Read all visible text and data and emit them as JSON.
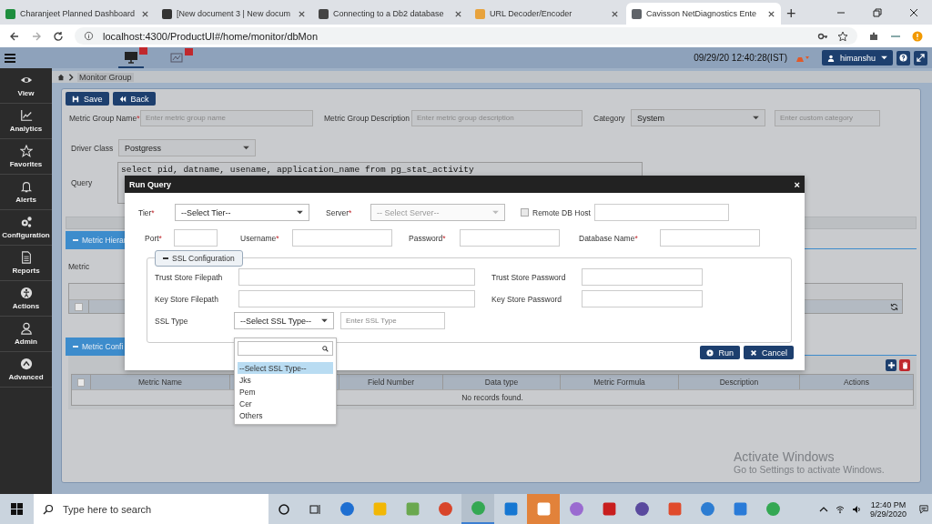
{
  "browser": {
    "tabs": [
      {
        "title": "Charanjeet Planned Dashboard",
        "kind": "sheet",
        "selected": false
      },
      {
        "title": "[New document 3 | New docum",
        "kind": "code",
        "selected": false
      },
      {
        "title": "Connecting to a Db2 database",
        "kind": "link",
        "selected": false
      },
      {
        "title": "URL Decoder/Encoder",
        "kind": "tool",
        "selected": false
      },
      {
        "title": "Cavisson NetDiagnostics Ente",
        "kind": "globe",
        "selected": true
      }
    ],
    "new_tab": "+",
    "url": "localhost:4300/ProductUI#/home/monitor/dbMon"
  },
  "app_header": {
    "datetime": "09/29/20 12:40:28(IST)",
    "user": "himanshu"
  },
  "sidebar": [
    {
      "label": "View",
      "kind": "eye"
    },
    {
      "label": "Analytics",
      "kind": "chart"
    },
    {
      "label": "Favorites",
      "kind": "star"
    },
    {
      "label": "Alerts",
      "kind": "bell"
    },
    {
      "label": "Configuration",
      "kind": "gears"
    },
    {
      "label": "Reports",
      "kind": "doc"
    },
    {
      "label": "Actions",
      "kind": "figure"
    },
    {
      "label": "Admin",
      "kind": "user"
    },
    {
      "label": "Advanced",
      "kind": "up"
    }
  ],
  "breadcrumb": "Monitor Group",
  "toolbar": [
    {
      "label": "Save",
      "kind": "save"
    },
    {
      "label": "Back",
      "kind": "back"
    }
  ],
  "form": {
    "group_name": {
      "label": "Metric Group Name",
      "mark": "*",
      "placeholder": "Enter metric group name"
    },
    "group_description": {
      "label": "Metric Group Description",
      "placeholder": "Enter metric group description"
    },
    "category": {
      "label": "Category",
      "value": "System"
    },
    "custom_category": {
      "placeholder": "Enter custom category"
    },
    "driver_class": {
      "label": "Driver Class",
      "value": "Postgress"
    },
    "query": {
      "label": "Query",
      "value": "select pid, datname, usename, application_name from pg_stat_activity"
    }
  },
  "hierarchy_section": {
    "title": "Metric Hierar",
    "metric_label": "Metric",
    "row_checkbox": {
      "checked": false
    }
  },
  "config_section": {
    "title": "Metric Confi",
    "header_checkbox": {
      "checked": false
    },
    "columns": [
      "Metric Name",
      "Field Number",
      "Data type",
      "Metric Formula",
      "Description",
      "Actions"
    ],
    "empty": "No records found."
  },
  "modal": {
    "title": "Run Query",
    "close": "×",
    "tier": {
      "label": "Tier",
      "mark": "*",
      "value": "--Select Tier--"
    },
    "server": {
      "label": "Server",
      "mark": "*",
      "placeholder": "-- Select Server--",
      "disabled": true
    },
    "remote_db_host": {
      "label": "Remote DB Host",
      "checked": false
    },
    "port": {
      "label": "Port",
      "mark": "*"
    },
    "username": {
      "label": "Username",
      "mark": "*"
    },
    "password": {
      "label": "Password",
      "mark": "*"
    },
    "database_name": {
      "label": "Database Name",
      "mark": "*"
    },
    "ssl": {
      "toggle": "SSL Configuration",
      "expanded": true,
      "trust_store_filepath": "Trust Store Filepath",
      "trust_store_password": "Trust Store Password",
      "key_store_filepath": "Key Store Filepath",
      "key_store_password": "Key Store Password",
      "ssl_type": {
        "label": "SSL Type",
        "value": "--Select SSL Type--"
      },
      "ssl_type_custom": {
        "placeholder": "Enter SSL Type"
      }
    },
    "buttons": [
      {
        "label": "Run",
        "kind": "run"
      },
      {
        "label": "Cancel",
        "kind": "cancel"
      }
    ]
  },
  "dropdown": {
    "options": [
      {
        "label": "--Select SSL Type--",
        "selected": true
      },
      {
        "label": "Jks",
        "selected": false
      },
      {
        "label": "Pem",
        "selected": false
      },
      {
        "label": "Cer",
        "selected": false
      },
      {
        "label": "Others",
        "selected": false
      }
    ]
  },
  "os_notice": {
    "title": "Activate Windows",
    "subtitle": "Go to Settings to activate Windows."
  },
  "taskbar": {
    "search_placeholder": "Type here to search",
    "time": "12:40 PM",
    "date": "9/29/2020"
  }
}
